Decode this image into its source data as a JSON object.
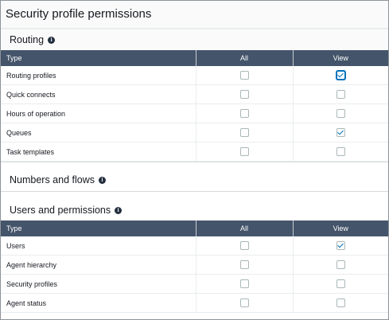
{
  "page": {
    "title": "Security profile permissions"
  },
  "sections": {
    "routing": {
      "title": "Routing",
      "columns": [
        "Type",
        "All",
        "View"
      ],
      "rows": [
        {
          "label": "Routing profiles",
          "all": false,
          "view": true
        },
        {
          "label": "Quick connects",
          "all": false,
          "view": false
        },
        {
          "label": "Hours of operation",
          "all": false,
          "view": false
        },
        {
          "label": "Queues",
          "all": false,
          "view": true
        },
        {
          "label": "Task templates",
          "all": false,
          "view": false
        }
      ]
    },
    "numbers_flows": {
      "title": "Numbers and flows"
    },
    "users_permissions": {
      "title": "Users and permissions",
      "columns": [
        "Type",
        "All",
        "View"
      ],
      "rows": [
        {
          "label": "Users",
          "all": false,
          "view": true
        },
        {
          "label": "Agent hierarchy",
          "all": false,
          "view": false
        },
        {
          "label": "Security profiles",
          "all": false,
          "view": false
        },
        {
          "label": "Agent status",
          "all": false,
          "view": false
        }
      ]
    }
  },
  "icons": {
    "info": "info-icon"
  },
  "colors": {
    "header_bg": "#44546a",
    "check": "#0073bb"
  }
}
